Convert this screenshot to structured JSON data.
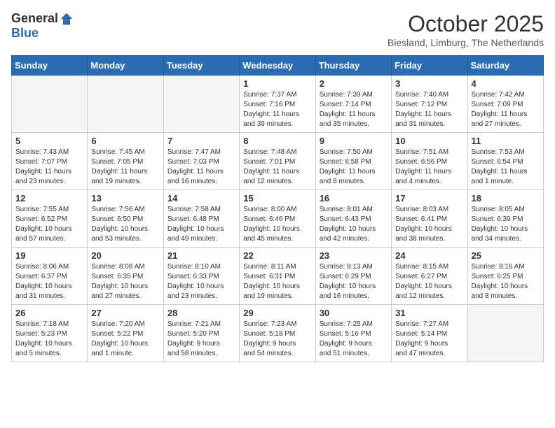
{
  "logo": {
    "general": "General",
    "blue": "Blue"
  },
  "title": "October 2025",
  "subtitle": "Biesland, Limburg, The Netherlands",
  "days_of_week": [
    "Sunday",
    "Monday",
    "Tuesday",
    "Wednesday",
    "Thursday",
    "Friday",
    "Saturday"
  ],
  "weeks": [
    [
      {
        "day": "",
        "info": ""
      },
      {
        "day": "",
        "info": ""
      },
      {
        "day": "",
        "info": ""
      },
      {
        "day": "1",
        "info": "Sunrise: 7:37 AM\nSunset: 7:16 PM\nDaylight: 11 hours\nand 39 minutes."
      },
      {
        "day": "2",
        "info": "Sunrise: 7:39 AM\nSunset: 7:14 PM\nDaylight: 11 hours\nand 35 minutes."
      },
      {
        "day": "3",
        "info": "Sunrise: 7:40 AM\nSunset: 7:12 PM\nDaylight: 11 hours\nand 31 minutes."
      },
      {
        "day": "4",
        "info": "Sunrise: 7:42 AM\nSunset: 7:09 PM\nDaylight: 11 hours\nand 27 minutes."
      }
    ],
    [
      {
        "day": "5",
        "info": "Sunrise: 7:43 AM\nSunset: 7:07 PM\nDaylight: 11 hours\nand 23 minutes."
      },
      {
        "day": "6",
        "info": "Sunrise: 7:45 AM\nSunset: 7:05 PM\nDaylight: 11 hours\nand 19 minutes."
      },
      {
        "day": "7",
        "info": "Sunrise: 7:47 AM\nSunset: 7:03 PM\nDaylight: 11 hours\nand 16 minutes."
      },
      {
        "day": "8",
        "info": "Sunrise: 7:48 AM\nSunset: 7:01 PM\nDaylight: 11 hours\nand 12 minutes."
      },
      {
        "day": "9",
        "info": "Sunrise: 7:50 AM\nSunset: 6:58 PM\nDaylight: 11 hours\nand 8 minutes."
      },
      {
        "day": "10",
        "info": "Sunrise: 7:51 AM\nSunset: 6:56 PM\nDaylight: 11 hours\nand 4 minutes."
      },
      {
        "day": "11",
        "info": "Sunrise: 7:53 AM\nSunset: 6:54 PM\nDaylight: 11 hours\nand 1 minute."
      }
    ],
    [
      {
        "day": "12",
        "info": "Sunrise: 7:55 AM\nSunset: 6:52 PM\nDaylight: 10 hours\nand 57 minutes."
      },
      {
        "day": "13",
        "info": "Sunrise: 7:56 AM\nSunset: 6:50 PM\nDaylight: 10 hours\nand 53 minutes."
      },
      {
        "day": "14",
        "info": "Sunrise: 7:58 AM\nSunset: 6:48 PM\nDaylight: 10 hours\nand 49 minutes."
      },
      {
        "day": "15",
        "info": "Sunrise: 8:00 AM\nSunset: 6:46 PM\nDaylight: 10 hours\nand 45 minutes."
      },
      {
        "day": "16",
        "info": "Sunrise: 8:01 AM\nSunset: 6:43 PM\nDaylight: 10 hours\nand 42 minutes."
      },
      {
        "day": "17",
        "info": "Sunrise: 8:03 AM\nSunset: 6:41 PM\nDaylight: 10 hours\nand 38 minutes."
      },
      {
        "day": "18",
        "info": "Sunrise: 8:05 AM\nSunset: 6:39 PM\nDaylight: 10 hours\nand 34 minutes."
      }
    ],
    [
      {
        "day": "19",
        "info": "Sunrise: 8:06 AM\nSunset: 6:37 PM\nDaylight: 10 hours\nand 31 minutes."
      },
      {
        "day": "20",
        "info": "Sunrise: 8:08 AM\nSunset: 6:35 PM\nDaylight: 10 hours\nand 27 minutes."
      },
      {
        "day": "21",
        "info": "Sunrise: 8:10 AM\nSunset: 6:33 PM\nDaylight: 10 hours\nand 23 minutes."
      },
      {
        "day": "22",
        "info": "Sunrise: 8:11 AM\nSunset: 6:31 PM\nDaylight: 10 hours\nand 19 minutes."
      },
      {
        "day": "23",
        "info": "Sunrise: 8:13 AM\nSunset: 6:29 PM\nDaylight: 10 hours\nand 16 minutes."
      },
      {
        "day": "24",
        "info": "Sunrise: 8:15 AM\nSunset: 6:27 PM\nDaylight: 10 hours\nand 12 minutes."
      },
      {
        "day": "25",
        "info": "Sunrise: 8:16 AM\nSunset: 6:25 PM\nDaylight: 10 hours\nand 8 minutes."
      }
    ],
    [
      {
        "day": "26",
        "info": "Sunrise: 7:18 AM\nSunset: 5:23 PM\nDaylight: 10 hours\nand 5 minutes."
      },
      {
        "day": "27",
        "info": "Sunrise: 7:20 AM\nSunset: 5:22 PM\nDaylight: 10 hours\nand 1 minute."
      },
      {
        "day": "28",
        "info": "Sunrise: 7:21 AM\nSunset: 5:20 PM\nDaylight: 9 hours\nand 58 minutes."
      },
      {
        "day": "29",
        "info": "Sunrise: 7:23 AM\nSunset: 5:18 PM\nDaylight: 9 hours\nand 54 minutes."
      },
      {
        "day": "30",
        "info": "Sunrise: 7:25 AM\nSunset: 5:16 PM\nDaylight: 9 hours\nand 51 minutes."
      },
      {
        "day": "31",
        "info": "Sunrise: 7:27 AM\nSunset: 5:14 PM\nDaylight: 9 hours\nand 47 minutes."
      },
      {
        "day": "",
        "info": ""
      }
    ]
  ]
}
